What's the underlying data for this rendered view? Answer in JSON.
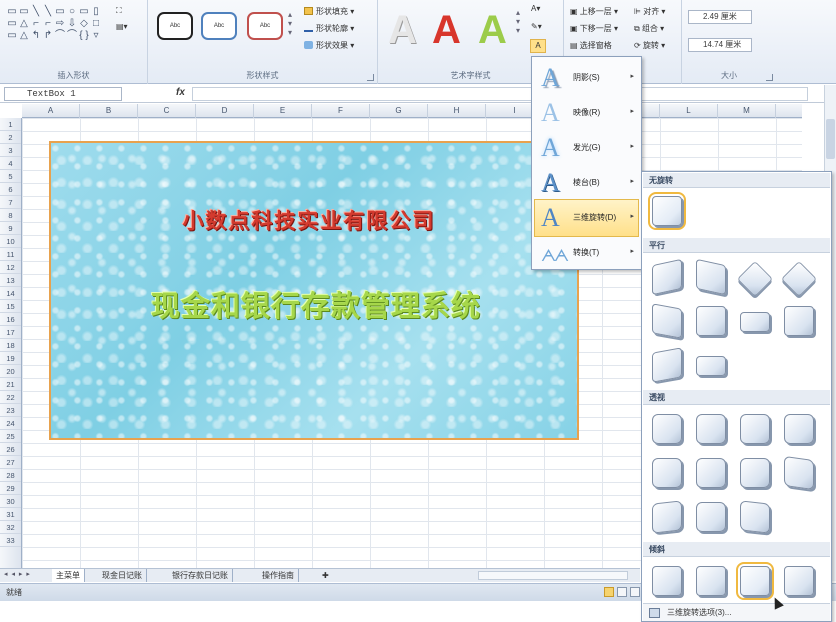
{
  "ribbon": {
    "groups": {
      "insert_shapes": "插入形状",
      "shape_styles": "形状样式",
      "wordart_styles": "艺术字样式",
      "size": "大小"
    },
    "shape_glyphs": [
      "▭",
      "▭",
      "╲",
      "╲",
      "▭",
      "○",
      "▭",
      "▯",
      "▭",
      "△",
      "⌐",
      "⌐",
      "⇨",
      "⇩",
      "◇",
      "□",
      "▭",
      "△",
      "↰",
      "↱",
      "⌒",
      "⌒",
      "{ }",
      "▿"
    ],
    "shape_styles": [
      "Abc",
      "Abc",
      "Abc"
    ],
    "shape_fill": "形状填充",
    "shape_outline": "形状轮廓",
    "shape_effects": "形状效果",
    "wordart_letters": [
      "A",
      "A",
      "A"
    ],
    "bring_forward": "上移一层",
    "send_backward": "下移一层",
    "selection_pane": "选择窗格",
    "align": "对齐",
    "group": "组合",
    "rotate": "旋转",
    "height": "2.49 厘米",
    "width": "14.74 厘米"
  },
  "formula_bar": {
    "name_box": "TextBox 1",
    "fx": "fx"
  },
  "sheet": {
    "columns": [
      "A",
      "B",
      "C",
      "D",
      "E",
      "F",
      "G",
      "H",
      "I",
      "",
      "",
      "L",
      "M"
    ],
    "rows": [
      "1",
      "2",
      "3",
      "4",
      "5",
      "6",
      "7",
      "8",
      "9",
      "10",
      "11",
      "12",
      "13",
      "14",
      "15",
      "16",
      "17",
      "18",
      "19",
      "20",
      "21",
      "22",
      "23",
      "24",
      "25",
      "26",
      "27",
      "28",
      "29",
      "30",
      "31",
      "32",
      "33"
    ]
  },
  "textbox": {
    "line1": "小数点科技实业有限公司",
    "line2": "现金和银行存款管理系统"
  },
  "sheet_tabs": {
    "nav": "◂ ◂ ▸ ▸",
    "tabs": [
      "主菜单",
      "现金日记账",
      "银行存款日记账",
      "操作指南"
    ]
  },
  "status": {
    "ready": "就绪"
  },
  "effects_menu": {
    "items": [
      {
        "label": "阴影(S)"
      },
      {
        "label": "映像(R)"
      },
      {
        "label": "发光(G)"
      },
      {
        "label": "棱台(B)"
      },
      {
        "label": "三维旋转(D)"
      },
      {
        "label": "转换(T)"
      }
    ],
    "selected_index": 4
  },
  "rotation_gallery": {
    "sections": {
      "none": "无旋转",
      "parallel": "平行",
      "perspective": "透视",
      "oblique": "倾斜"
    },
    "footer": "三维旋转选项(3)..."
  },
  "colors": {
    "textbox_border": "#e8a24e",
    "textbox_fill": "#8fd6e9",
    "line1_text": "#d33a2e",
    "line2_text": "#a6d74a",
    "menu_highlight": "#ffe08a"
  }
}
